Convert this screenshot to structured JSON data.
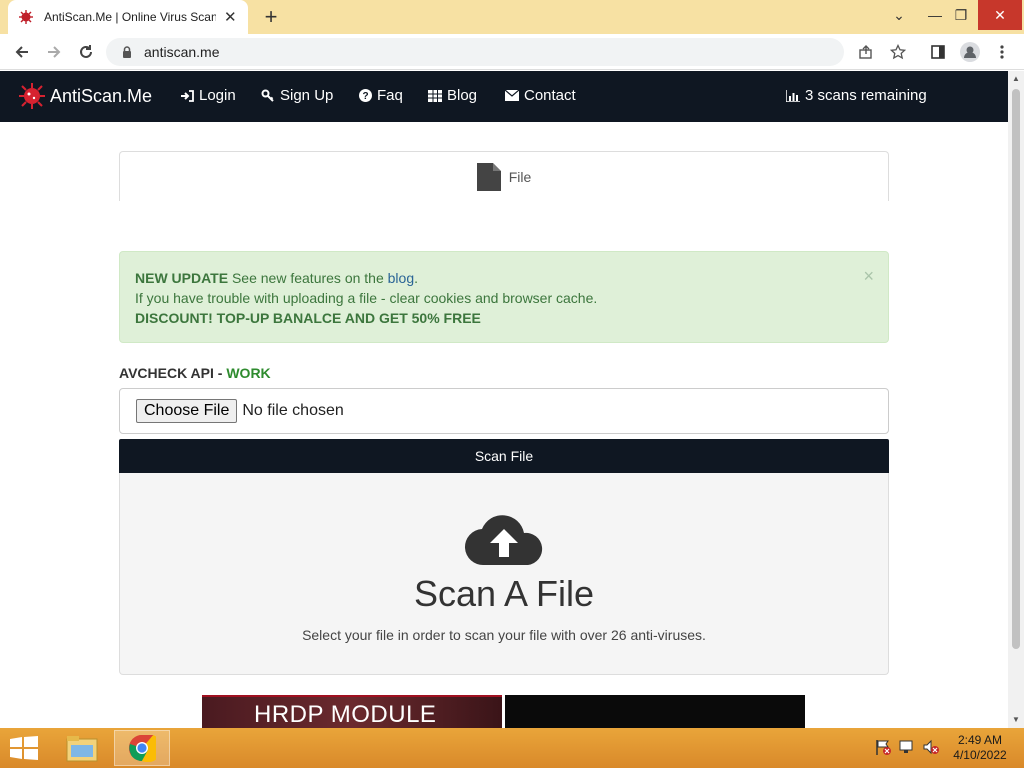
{
  "browser": {
    "tab_title": "AntiScan.Me | Online Virus Scann",
    "tab_close": "✕",
    "new_tab": "+",
    "url": "antiscan.me",
    "win_min": "⌄",
    "win_minimize": "—",
    "win_restore": "❐",
    "win_close": "✕"
  },
  "nav": {
    "brand": "AntiScan.Me",
    "links": {
      "login": "Login",
      "signup": "Sign Up",
      "faq": "Faq",
      "blog": "Blog",
      "contact": "Contact"
    },
    "scans_remaining": "3 scans remaining"
  },
  "tabs": {
    "file": "File"
  },
  "alert": {
    "update_label": "NEW UPDATE",
    "update_text": " See new features on the ",
    "blog_link": "blog",
    "update_end": ".",
    "trouble_text": "If you have trouble with uploading a file - clear cookies and browser cache.",
    "discount": "DISCOUNT! TOP-UP BANALCE AND GET 50% FREE",
    "close": "×"
  },
  "api": {
    "label": "AVCHECK API - ",
    "status": "WORK"
  },
  "upload": {
    "choose_label": "Choose File",
    "no_file": "No file chosen",
    "scan_button": "Scan File",
    "title": "Scan A File",
    "subtitle": "Select your file in order to scan your file with over 26 anti-viruses."
  },
  "banner": {
    "text": "HRDP MODULE"
  },
  "taskbar": {
    "time": "2:49 AM",
    "date": "4/10/2022"
  }
}
